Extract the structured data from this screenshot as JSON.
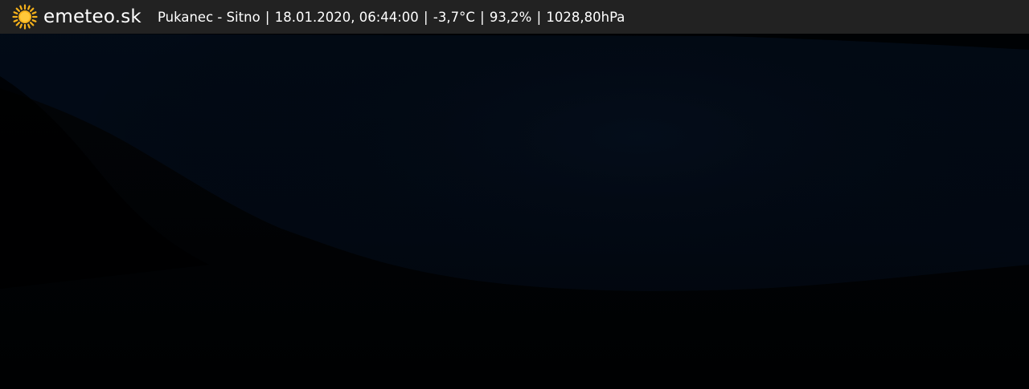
{
  "header": {
    "brand": "emeteo.sk",
    "logo_icon": "sun-icon",
    "location": "Pukanec - Sitno",
    "datetime": "18.01.2020, 06:44:00",
    "temperature": "-3,7°C",
    "humidity": "93,2%",
    "pressure": "1028,80hPa",
    "separator": " | "
  },
  "colors": {
    "header_bg": "#222222",
    "header_text": "#ffffff",
    "sun": "#f6b21b",
    "sky": "#020b16",
    "ground": "#010203"
  }
}
